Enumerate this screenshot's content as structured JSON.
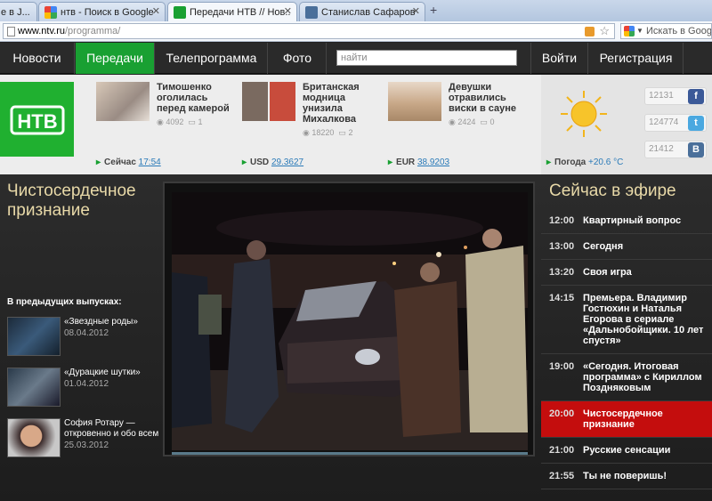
{
  "browser": {
    "tabs": [
      {
        "label": "e в J..."
      },
      {
        "label": "нтв - Поиск в Google"
      },
      {
        "label": "Передачи НТВ // Нов..."
      },
      {
        "label": "Станислав Сафаров"
      }
    ],
    "url_host": "www.ntv.ru",
    "url_path": "/programma/",
    "search_placeholder": "Искать в Google"
  },
  "nav": {
    "items": [
      "Новости",
      "Передачи",
      "Телепрограмма",
      "Фото"
    ],
    "search_placeholder": "найти",
    "login": "Войти",
    "register": "Регистрация"
  },
  "logo": {
    "text": "НТВ"
  },
  "news": [
    {
      "title": "Тимошенко оголилась перед камерой",
      "views": "4092",
      "comments": "1"
    },
    {
      "title": "Британская модница унизила Михалкова",
      "views": "18220",
      "comments": "2"
    },
    {
      "title": "Девушки отравились виски в сауне",
      "views": "2424",
      "comments": "0"
    }
  ],
  "ticker": {
    "now_label": "Сейчас",
    "now_value": "17:54",
    "usd_label": "USD",
    "usd_value": "29.3627",
    "eur_label": "EUR",
    "eur_value": "38.9203"
  },
  "weather": {
    "label": "Погода",
    "temp": "+20.6 °C"
  },
  "social": [
    {
      "count": "12131",
      "icon": "f",
      "color": "#3b5998"
    },
    {
      "count": "124774",
      "icon": "t",
      "color": "#4aa8e0"
    },
    {
      "count": "21412",
      "icon": "В",
      "color": "#4a6f9a"
    }
  ],
  "show": {
    "title": "Чистосердечное признание",
    "previous_heading": "В предыдущих выпусках:",
    "previous": [
      {
        "title": "«Звездные роды»",
        "date": "08.04.2012"
      },
      {
        "title": "«Дурацкие шутки»",
        "date": "01.04.2012"
      },
      {
        "title": "София Ротару — откровенно и обо всем",
        "date": "25.03.2012"
      }
    ]
  },
  "onair": {
    "title": "Сейчас в эфире",
    "schedule": [
      {
        "time": "12:00",
        "title": "Квартирный вопрос"
      },
      {
        "time": "13:00",
        "title": "Сегодня"
      },
      {
        "time": "13:20",
        "title": "Своя игра"
      },
      {
        "time": "14:15",
        "title": "Премьера. Владимир Гостюхин и Наталья Егорова в сериале «Дальнобойщики. 10 лет спустя»"
      },
      {
        "time": "19:00",
        "title": "«Сегодня. Итоговая программа» с Кириллом Поздняковым"
      },
      {
        "time": "20:00",
        "title": "Чистосердечное признание",
        "current": true
      },
      {
        "time": "21:00",
        "title": "Русские сенсации"
      },
      {
        "time": "21:55",
        "title": "Ты не поверишь!"
      }
    ]
  }
}
